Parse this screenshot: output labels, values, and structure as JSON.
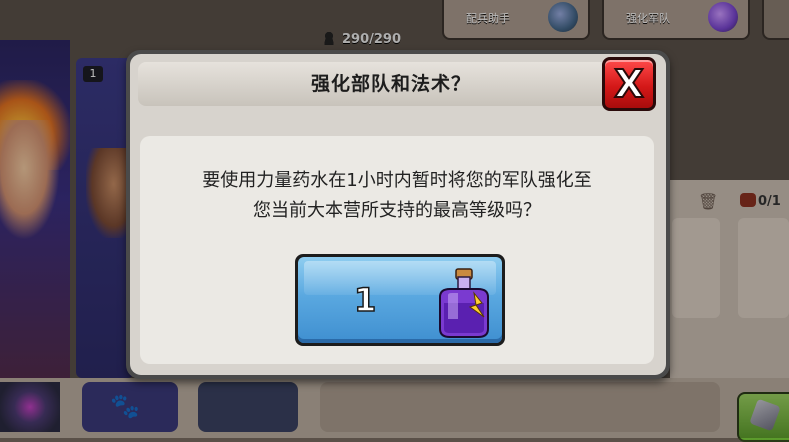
{
  "header": {
    "tab_siege": "配兵助手",
    "tab_boost": "强化军队",
    "capacity": "290/290"
  },
  "background": {
    "card_level": "1",
    "army_count": "0/1"
  },
  "dialog": {
    "title": "强化部队和法术？",
    "close_label": "X",
    "message_line1": "要使用力量药水在1小时内暂时将您的军队强化至",
    "message_line2": "您当前大本营所支持的最高等级吗？",
    "cost": "1",
    "cost_icon": "power-potion-icon"
  },
  "colors": {
    "close_button": "#e02020",
    "confirm_button": "#5aa8e0",
    "potion": "#7a3ad0"
  }
}
